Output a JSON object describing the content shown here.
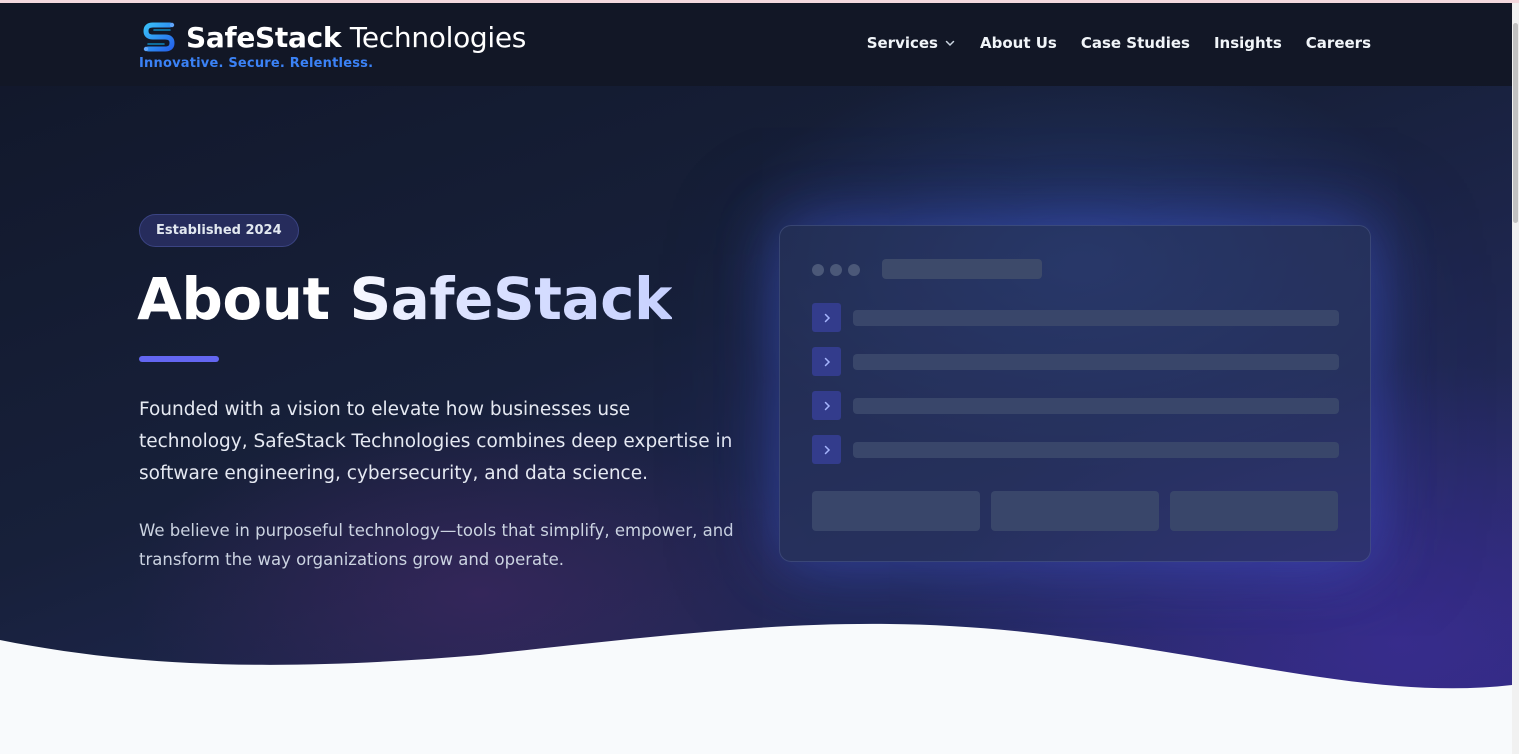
{
  "header": {
    "brand_bold": "SafeStack",
    "brand_light": "Technologies",
    "tagline": "Innovative. Secure. Relentless.",
    "logo_icon": "safestack-s-logo-icon",
    "nav": [
      {
        "label": "Services",
        "has_dropdown": true
      },
      {
        "label": "About Us"
      },
      {
        "label": "Case Studies"
      },
      {
        "label": "Insights"
      },
      {
        "label": "Careers"
      }
    ]
  },
  "hero": {
    "badge": "Established 2024",
    "title": "About SafeStack",
    "lead": "Founded with a vision to elevate how businesses use technology, SafeStack Technologies combines deep expertise in software engineering, cybersecurity, and data science.",
    "sub": "We believe in purposeful technology—tools that simplify, empower, and transform the way organizations grow and operate."
  },
  "colors": {
    "accent": "#6366f1",
    "tagline_blue": "#3b82f6",
    "nav_bg": "#121726",
    "page_bg": "#f8fafc"
  }
}
